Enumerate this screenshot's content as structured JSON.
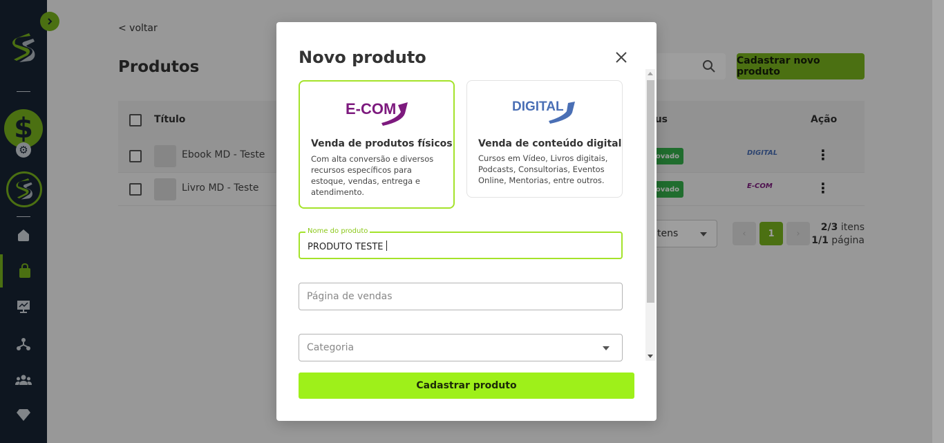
{
  "sidebar": {
    "toggle_icon": "chevron-right-icon",
    "nav_items": [
      {
        "name": "home",
        "icon": "home-icon"
      },
      {
        "name": "products",
        "icon": "bag-icon",
        "active": true
      },
      {
        "name": "reports",
        "icon": "chart-icon"
      },
      {
        "name": "affiliates",
        "icon": "network-icon"
      },
      {
        "name": "members",
        "icon": "users-icon"
      },
      {
        "name": "premium",
        "icon": "diamond-icon"
      }
    ]
  },
  "page": {
    "back_label": "< voltar",
    "title": "Produtos",
    "new_product_label": "Cadastrar novo produto",
    "table": {
      "headers": {
        "title": "Título",
        "status": "tus",
        "action": "Ação"
      },
      "rows": [
        {
          "title": "Ebook MD - Teste",
          "status": "ovado",
          "type": "DIGITAL",
          "type_color": "#4a6fb5"
        },
        {
          "title": "Livro MD - Teste",
          "status": "ovado",
          "type": "E-COM",
          "type_color": "#7d1a7e"
        }
      ]
    },
    "per_page_label": "tens",
    "current_page": "1",
    "items_info": "2/3",
    "items_suffix": " itens",
    "page_info": "1/1",
    "page_suffix": " página"
  },
  "modal": {
    "title": "Novo produto",
    "cards": {
      "ecom": {
        "logo_text": "E-COM",
        "logo_color": "#7d1a7e",
        "heading": "Venda de produtos físicos",
        "description": "Com alta conversão e diversos recursos específicos para estoque, vendas, entrega e atendimento."
      },
      "digital": {
        "logo_text": "DIGITAL",
        "logo_color": "#4a6fb5",
        "heading": "Venda de conteúdo digital",
        "description": "Cursos em Vídeo, Livros digitais, Podcasts, Consultorias, Eventos Online, Mentorias, entre outros."
      }
    },
    "fields": {
      "name_label": "Nome do produto",
      "name_value": "PRODUTO TESTE",
      "sales_page_placeholder": "Página de vendas",
      "category_placeholder": "Categoria"
    },
    "submit_label": "Cadastrar produto"
  },
  "colors": {
    "accent": "#7ab51d",
    "accent_bright": "#9ef01a",
    "sidebar_bg": "#182535",
    "approved": "#35b04b"
  }
}
